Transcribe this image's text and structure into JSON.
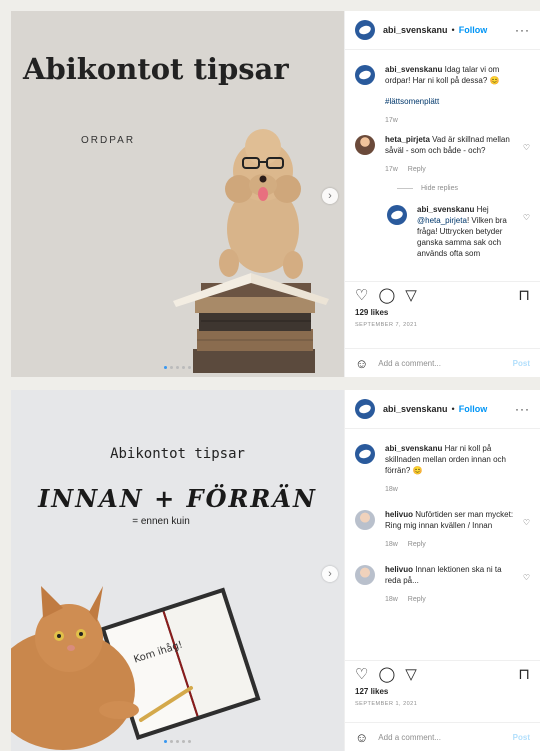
{
  "posts": [
    {
      "image": {
        "title": "Abikontot tipsar",
        "subtitle": "ORDPAR"
      },
      "header": {
        "username": "abi_svenskanu",
        "separator": "•",
        "follow": "Follow",
        "more": "···"
      },
      "caption": {
        "username": "abi_svenskanu",
        "text": "Idag talar vi om ordpar! Har ni koll på dessa? 😊",
        "hashtag": "#lättsomenplätt",
        "age": "17w"
      },
      "comments": [
        {
          "username": "heta_pirjeta",
          "text": "Vad är skillnad mellan såväl - som och både - och?",
          "age": "17w",
          "reply": "Reply",
          "hide_replies": "Hide replies",
          "replies": [
            {
              "username": "abi_svenskanu",
              "text_before": "Hej ",
              "mention": "@heta_pirjeta",
              "text_after": "! Vilken bra fråga! Uttrycken betyder ganska samma sak och används ofta som"
            }
          ]
        }
      ],
      "likes": "129 likes",
      "date": "SEPTEMBER 7, 2021",
      "add_comment": "Add a comment...",
      "post_button": "Post"
    },
    {
      "image": {
        "title": "Abikontot tipsar",
        "big_title": "INNAN + FÖRRÄN",
        "subtitle": "= ennen kuin",
        "notebook_text": "Kom ihåg!"
      },
      "header": {
        "username": "abi_svenskanu",
        "separator": "•",
        "follow": "Follow",
        "more": "···"
      },
      "caption": {
        "username": "abi_svenskanu",
        "text": "Har ni koll på skillnaden mellan orden innan och förrän? 😊",
        "age": "18w"
      },
      "comments": [
        {
          "username": "helivuo",
          "text": "Nuförtiden ser man mycket: Ring mig innan kvällen / Innan",
          "age": "18w",
          "reply": "Reply"
        },
        {
          "username": "helivuo",
          "text": "Innan lektionen ska ni ta reda på...",
          "age": "18w",
          "reply": "Reply"
        }
      ],
      "likes": "127 likes",
      "date": "SEPTEMBER 1, 2021",
      "add_comment": "Add a comment...",
      "post_button": "Post"
    }
  ],
  "colors": {
    "link": "#0095f6",
    "hashtag": "#00376b",
    "muted": "#8e8e8e",
    "avatar": "#2a5a9c"
  }
}
